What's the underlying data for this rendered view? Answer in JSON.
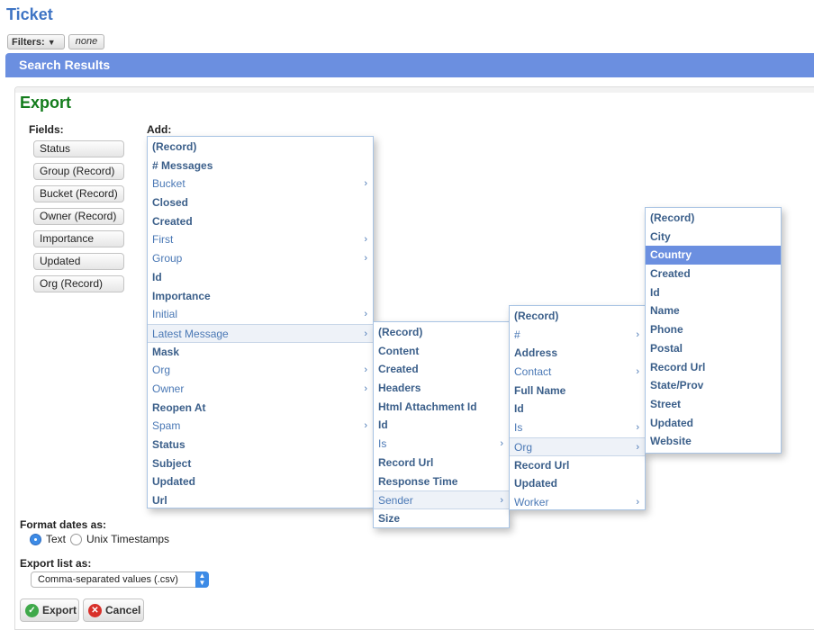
{
  "page": {
    "title": "Ticket"
  },
  "filters": {
    "label": "Filters:",
    "value": "none"
  },
  "search_results": {
    "label": "Search Results"
  },
  "export": {
    "title": "Export",
    "fields_label": "Fields:",
    "add_label": "Add:",
    "fields": [
      "Status",
      "Group (Record)",
      "Bucket (Record)",
      "Owner (Record)",
      "Importance",
      "Updated",
      "Org (Record)"
    ],
    "menu1": [
      {
        "label": "(Record)",
        "bold": true
      },
      {
        "label": "# Messages",
        "bold": true
      },
      {
        "label": "Bucket",
        "sub": true
      },
      {
        "label": "Closed",
        "bold": true
      },
      {
        "label": "Created",
        "bold": true
      },
      {
        "label": "First",
        "sub": true
      },
      {
        "label": "Group",
        "sub": true
      },
      {
        "label": "Id",
        "bold": true
      },
      {
        "label": "Importance",
        "bold": true
      },
      {
        "label": "Initial",
        "sub": true
      },
      {
        "label": "Latest Message",
        "sub": true,
        "highlight": true
      },
      {
        "label": "Mask",
        "bold": true
      },
      {
        "label": "Org",
        "sub": true
      },
      {
        "label": "Owner",
        "sub": true
      },
      {
        "label": "Reopen At",
        "bold": true
      },
      {
        "label": "Spam",
        "sub": true
      },
      {
        "label": "Status",
        "bold": true
      },
      {
        "label": "Subject",
        "bold": true
      },
      {
        "label": "Updated",
        "bold": true
      },
      {
        "label": "Url",
        "bold": true
      }
    ],
    "menu2": [
      {
        "label": "(Record)",
        "bold": true
      },
      {
        "label": "Content",
        "bold": true
      },
      {
        "label": "Created",
        "bold": true
      },
      {
        "label": "Headers",
        "bold": true
      },
      {
        "label": "Html Attachment Id",
        "bold": true
      },
      {
        "label": "Id",
        "bold": true
      },
      {
        "label": "Is",
        "sub": true
      },
      {
        "label": "Record Url",
        "bold": true
      },
      {
        "label": "Response Time",
        "bold": true
      },
      {
        "label": "Sender",
        "sub": true,
        "highlight": true
      },
      {
        "label": "Size",
        "bold": true
      }
    ],
    "menu3": [
      {
        "label": "(Record)",
        "bold": true
      },
      {
        "label": "#",
        "sub": true
      },
      {
        "label": "Address",
        "bold": true
      },
      {
        "label": "Contact",
        "sub": true
      },
      {
        "label": "Full Name",
        "bold": true
      },
      {
        "label": "Id",
        "bold": true
      },
      {
        "label": "Is",
        "sub": true
      },
      {
        "label": "Org",
        "sub": true,
        "highlight": true
      },
      {
        "label": "Record Url",
        "bold": true
      },
      {
        "label": "Updated",
        "bold": true
      },
      {
        "label": "Worker",
        "sub": true
      }
    ],
    "menu4": [
      {
        "label": "(Record)",
        "bold": true
      },
      {
        "label": "City",
        "bold": true
      },
      {
        "label": "Country",
        "bold": true,
        "selected": true
      },
      {
        "label": "Created",
        "bold": true
      },
      {
        "label": "Id",
        "bold": true
      },
      {
        "label": "Name",
        "bold": true
      },
      {
        "label": "Phone",
        "bold": true
      },
      {
        "label": "Postal",
        "bold": true
      },
      {
        "label": "Record Url",
        "bold": true
      },
      {
        "label": "State/Prov",
        "bold": true
      },
      {
        "label": "Street",
        "bold": true
      },
      {
        "label": "Updated",
        "bold": true
      },
      {
        "label": "Website",
        "bold": true
      }
    ],
    "format_dates_label": "Format dates as:",
    "date_options": [
      {
        "label": "Text",
        "checked": true
      },
      {
        "label": "Unix Timestamps",
        "checked": false
      }
    ],
    "export_list_label": "Export list as:",
    "export_list_value": "Comma-separated values (.csv)",
    "export_button": "Export",
    "cancel_button": "Cancel"
  },
  "colors": {
    "accent": "#6b8fe0",
    "title": "#3e74c4",
    "export_title": "#137c1c"
  }
}
